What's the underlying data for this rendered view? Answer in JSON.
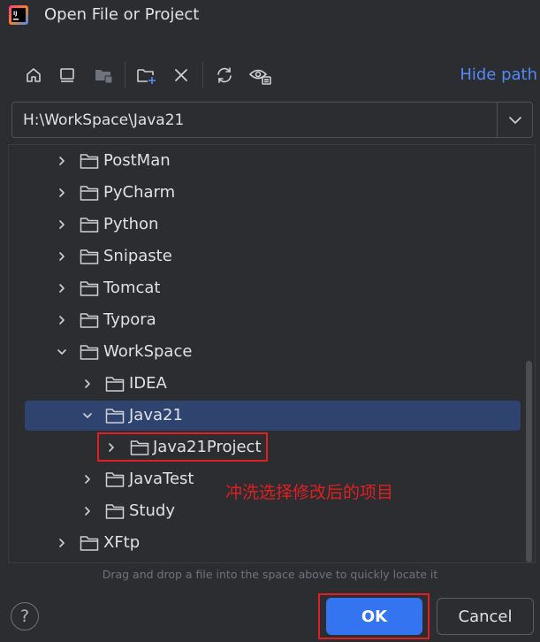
{
  "window": {
    "title": "Open File or Project"
  },
  "toolbar": {
    "icons": [
      "home-icon",
      "desktop-icon",
      "project-folder-icon",
      "new-folder-icon",
      "delete-icon",
      "refresh-icon",
      "show-hidden-icon"
    ],
    "hide_path": "Hide path"
  },
  "path": {
    "value": "H:\\WorkSpace\\Java21"
  },
  "tree": {
    "items": [
      {
        "label": "PostMan",
        "expanded": false,
        "selected": false
      },
      {
        "label": "PyCharm",
        "expanded": false,
        "selected": false
      },
      {
        "label": "Python",
        "expanded": false,
        "selected": false
      },
      {
        "label": "Snipaste",
        "expanded": false,
        "selected": false
      },
      {
        "label": "Tomcat",
        "expanded": false,
        "selected": false
      },
      {
        "label": "Typora",
        "expanded": false,
        "selected": false
      },
      {
        "label": "WorkSpace",
        "expanded": true,
        "selected": false
      },
      {
        "label": "IDEA",
        "expanded": false,
        "selected": false
      },
      {
        "label": "Java21",
        "expanded": true,
        "selected": true
      },
      {
        "label": "Java21Project",
        "expanded": false,
        "selected": false
      },
      {
        "label": "JavaTest",
        "expanded": false,
        "selected": false
      },
      {
        "label": "Study",
        "expanded": false,
        "selected": false
      },
      {
        "label": "XFtp",
        "expanded": false,
        "selected": false
      }
    ]
  },
  "annotation": {
    "text": "冲洗选择修改后的项目"
  },
  "hint": {
    "drop": "Drag and drop a file into the space above to quickly locate it"
  },
  "buttons": {
    "help": "?",
    "ok": "OK",
    "cancel": "Cancel"
  },
  "colors": {
    "background": "#2b2d30",
    "selection": "#2e436e",
    "accent": "#3574f0",
    "link": "#548af7",
    "annotation": "#e02020"
  }
}
